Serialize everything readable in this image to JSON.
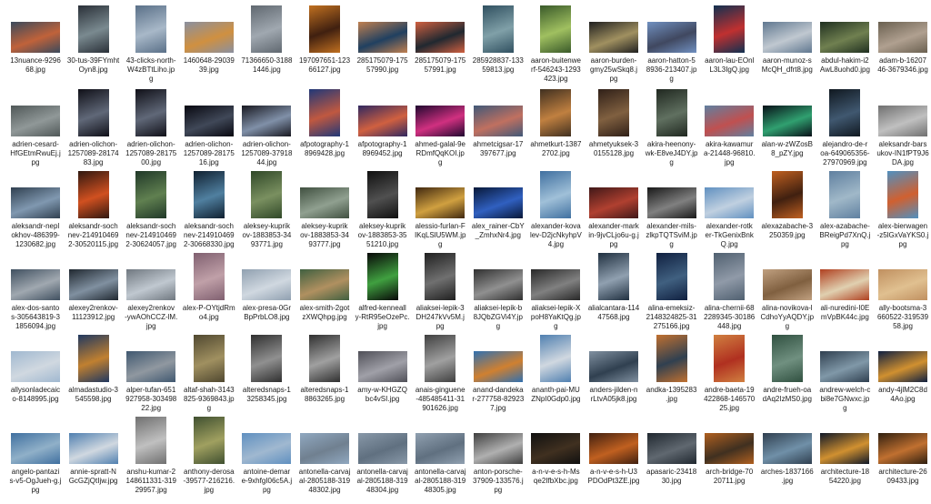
{
  "files": [
    [
      {
        "name": "13nuance-9296\n68.jpg",
        "c": "#3a4a5c",
        "c2": "#c0623a",
        "o": "l"
      },
      {
        "name": "30-tus-39FYmht\nOyn8.jpg",
        "c": "#2a3038",
        "c2": "#7a8a90",
        "o": "p"
      },
      {
        "name": "43-clicks-north-\nW4zBTtLiho.jp\ng",
        "c": "#5a7088",
        "c2": "#a8b8c8",
        "o": "p"
      },
      {
        "name": "1460648-29039\n39.jpg",
        "c": "#8a90a0",
        "c2": "#d09040",
        "o": "l"
      },
      {
        "name": "71366650-3188\n1446.jpg",
        "c": "#606870",
        "c2": "#a0a8b0",
        "o": "p"
      },
      {
        "name": "197097651-123\n66127.jpg",
        "c": "#c07020",
        "c2": "#402010",
        "o": "p"
      },
      {
        "name": "285175079-175\n57990.jpg",
        "c": "#c08050",
        "c2": "#204060",
        "o": "l"
      },
      {
        "name": "285175079-175\n57991.jpg",
        "c": "#d06040",
        "c2": "#202830",
        "o": "l"
      },
      {
        "name": "285928837-133\n59813.jpg",
        "c": "#305060",
        "c2": "#80a0a8",
        "o": "p"
      },
      {
        "name": "aaron-buitenwe\nrf-546243-1293\n423.jpg",
        "c": "#3a5a2a",
        "c2": "#a0c060",
        "o": "p"
      },
      {
        "name": "aaron-burden-\ngmy25wSkq8.j\npg",
        "c": "#202020",
        "c2": "#a09060",
        "o": "l"
      },
      {
        "name": "aaron-hatton-5\n8936-213407.jp\ng",
        "c": "#7090c0",
        "c2": "#404860",
        "o": "l"
      },
      {
        "name": "aaron-lau-EOnl\nL3L3IgQ.jpg",
        "c": "#103050",
        "c2": "#c03030",
        "o": "p"
      },
      {
        "name": "aaron-munoz-s\nMcQH_dfrt8.jpg",
        "c": "#607890",
        "c2": "#c0c8d0",
        "o": "l"
      },
      {
        "name": "abdul-hakim-i2\nAwL8uohd0.jpg",
        "c": "#203020",
        "c2": "#708050",
        "o": "l"
      },
      {
        "name": "adam-b-16207\n46-3679346.jpg",
        "c": "#6a6050",
        "c2": "#b0a090",
        "o": "l"
      }
    ],
    [
      {
        "name": "adrien-cesard-\nHfGEtmRwuEj.j\npg",
        "c": "#505858",
        "c2": "#909898",
        "o": "l"
      },
      {
        "name": "adrien-olichon-\n1257089-28174\n83.jpg",
        "c": "#101018",
        "c2": "#606878",
        "o": "p"
      },
      {
        "name": "adrien-olichon-\n1257089-28175\n00.jpg",
        "c": "#101018",
        "c2": "#606878",
        "o": "p"
      },
      {
        "name": "adrien-olichon-\n1257089-28175\n16.jpg",
        "c": "#080810",
        "c2": "#404858",
        "o": "l"
      },
      {
        "name": "adrien-olichon-\n1257089-37918\n44.jpg",
        "c": "#181820",
        "c2": "#8090a8",
        "o": "l"
      },
      {
        "name": "afpotography-1\n8969428.jpg",
        "c": "#203878",
        "c2": "#c05840",
        "o": "p"
      },
      {
        "name": "afpotography-1\n8969452.jpg",
        "c": "#302860",
        "c2": "#d06040",
        "o": "l"
      },
      {
        "name": "ahmed-galal-9e\nRDmfQqKOI.jp\ng",
        "c": "#200830",
        "c2": "#d03080",
        "o": "l"
      },
      {
        "name": "ahmetcigsar-17\n397677.jpg",
        "c": "#405878",
        "c2": "#c07060",
        "o": "l"
      },
      {
        "name": "ahmetkurt-1387\n2702.jpg",
        "c": "#403020",
        "c2": "#c08040",
        "o": "p"
      },
      {
        "name": "ahmetyuksek-3\n0155128.jpg",
        "c": "#302018",
        "c2": "#806040",
        "o": "p"
      },
      {
        "name": "akira-heenony-\nwk-E8veJ4DY.jp\ng",
        "c": "#202820",
        "c2": "#607060",
        "o": "p"
      },
      {
        "name": "akira-kawamur\na-21448-96810.\njpg",
        "c": "#6080a0",
        "c2": "#c05050",
        "o": "l"
      },
      {
        "name": "alan-w-zWZosB\n8_pZY.jpg",
        "c": "#081018",
        "c2": "#30a070",
        "o": "l"
      },
      {
        "name": "alejandro-de-r\noa-649065356-\n27970969.jpg",
        "c": "#101820",
        "c2": "#405870",
        "o": "p"
      },
      {
        "name": "aleksandr-bars\nukov-IN1fPT9J6\nDA.jpg",
        "c": "#707070",
        "c2": "#c0c0c0",
        "o": "l"
      }
    ],
    [
      {
        "name": "aleksandr-nepl\nokhov-486399-\n1230682.jpg",
        "c": "#304050",
        "c2": "#8098b0",
        "o": "l"
      },
      {
        "name": "aleksandr-soch\nnev-214910469\n2-30520115.jpg",
        "c": "#301810",
        "c2": "#d05020",
        "o": "p"
      },
      {
        "name": "aleksandr-soch\nnev-214910469\n2-30624057.jpg",
        "c": "#203828",
        "c2": "#608050",
        "o": "p"
      },
      {
        "name": "aleksandr-soch\nnev-214910469\n2-30668330.jpg",
        "c": "#102030",
        "c2": "#5080a0",
        "o": "p"
      },
      {
        "name": "aleksey-kuprik\nov-1883853-34\n93771.jpg",
        "c": "#304828",
        "c2": "#7a9060",
        "o": "p"
      },
      {
        "name": "aleksey-kuprik\nov-1883853-34\n93777.jpg",
        "c": "#405040",
        "c2": "#90a090",
        "o": "l"
      },
      {
        "name": "aleksey-kuprik\nov-1883853-35\n51210.jpg",
        "c": "#101010",
        "c2": "#505050",
        "o": "p"
      },
      {
        "name": "alessio-furlan-F\nIKqLSlU5WM.jp\ng",
        "c": "#402810",
        "c2": "#d0a040",
        "o": "l"
      },
      {
        "name": "alex_rainer-CbY\n_ZmhxNr4.jpg",
        "c": "#081838",
        "c2": "#3060c0",
        "o": "l"
      },
      {
        "name": "alexander-kova\nlev-D2jcNkyhpV\n4.jpg",
        "c": "#4070a0",
        "c2": "#a0c0d8",
        "o": "p"
      },
      {
        "name": "alexander-mark\nin-9jvCLjo6u-g.j\npg",
        "c": "#401818",
        "c2": "#b04030",
        "o": "l"
      },
      {
        "name": "alexander-mils-\nzlkpTQTSviM.jp\ng",
        "c": "#181818",
        "c2": "#808080",
        "o": "l"
      },
      {
        "name": "alexander-rotk\ner-TkGenixBnk\nQ.jpg",
        "c": "#6090c0",
        "c2": "#c0d0e0",
        "o": "l"
      },
      {
        "name": "alexazabache-3\n250359.jpg",
        "c": "#c06020",
        "c2": "#402010",
        "o": "p"
      },
      {
        "name": "alex-azabache-\nBReigPd7XnQ.j\npg",
        "c": "#6080a0",
        "c2": "#a0b8c8",
        "o": "p"
      },
      {
        "name": "alex-bierwagen\n-z5lGxVaYKS0.j\npg",
        "c": "#5090c0",
        "c2": "#d06030",
        "o": "p"
      }
    ],
    [
      {
        "name": "alex-dos-santo\ns-305643819-3\n1856094.jpg",
        "c": "#405060",
        "c2": "#a0a8b0",
        "o": "l"
      },
      {
        "name": "alexey2renkov-\n11123912.jpg",
        "c": "#202830",
        "c2": "#8090a0",
        "o": "l"
      },
      {
        "name": "alexey2renkov\n-ywAOhCCZ-lM.\njpg",
        "c": "#707880",
        "c2": "#c0c8d0",
        "o": "l"
      },
      {
        "name": "alex-P-OYtjdRm\no4.jpg",
        "c": "#806070",
        "c2": "#c0a0a8",
        "o": "p"
      },
      {
        "name": "alex-presa-0Gr\nBpPrbLO8.jpg",
        "c": "#90a0b0",
        "c2": "#d0d8e0",
        "o": "l"
      },
      {
        "name": "alex-smith-2got\nzXWQhpg.jpg",
        "c": "#406040",
        "c2": "#b09060",
        "o": "l"
      },
      {
        "name": "alfred-kenneall\ny-RtR95eOzePc.\njpg",
        "c": "#080808",
        "c2": "#40a040",
        "o": "p"
      },
      {
        "name": "aliaksei-lepik-3\nDH247kVv5M.j\npg",
        "c": "#202020",
        "c2": "#707070",
        "o": "p"
      },
      {
        "name": "aliaksei-lepik-b\n8JQbZGVi4Y.jp\ng",
        "c": "#303030",
        "c2": "#909090",
        "o": "l"
      },
      {
        "name": "aliaksei-lepik-X\npoH8YaKtQg.jp\ng",
        "c": "#282828",
        "c2": "#808080",
        "o": "l"
      },
      {
        "name": "alialcantara-114\n47568.jpg",
        "c": "#203040",
        "c2": "#90a0b0",
        "o": "p"
      },
      {
        "name": "alina-emeksiz-\n2148324825-31\n275166.jpg",
        "c": "#102040",
        "c2": "#406080",
        "o": "p"
      },
      {
        "name": "alina-chernii-68\n2289345-30186\n448.jpg",
        "c": "#506070",
        "c2": "#909aa8",
        "o": "p"
      },
      {
        "name": "alina-novikova-l\nCdhoYyAQDY.jp\ng",
        "c": "#c0a080",
        "c2": "#806040",
        "o": "l"
      },
      {
        "name": "ali-nuredini-I0E\nmVpBK44c.jpg",
        "c": "#b04020",
        "c2": "#e0d0b0",
        "o": "l"
      },
      {
        "name": "ally-bootsma-3\n660522-319539\n58.jpg",
        "c": "#c09060",
        "c2": "#e0c090",
        "o": "l"
      }
    ],
    [
      {
        "name": "allysonladecaic\no-8148995.jpg",
        "c": "#a0b8d0",
        "c2": "#d0d8e0",
        "o": "l"
      },
      {
        "name": "almadastudio-3\n545598.jpg",
        "c": "#203860",
        "c2": "#c08030",
        "o": "p"
      },
      {
        "name": "alper-tufan-651\n927958-303498\n22.jpg",
        "c": "#405870",
        "c2": "#9098a0",
        "o": "l"
      },
      {
        "name": "altaf-shah-3143\n825-9369843.jp\ng",
        "c": "#504830",
        "c2": "#a09060",
        "o": "p"
      },
      {
        "name": "alteredsnaps-1\n3258345.jpg",
        "c": "#303030",
        "c2": "#909090",
        "o": "p"
      },
      {
        "name": "alteredsnaps-1\n8863265.jpg",
        "c": "#303030",
        "c2": "#a0a0a0",
        "o": "p"
      },
      {
        "name": "amy-w-KHGZQ\nbc4vSI.jpg",
        "c": "#505058",
        "c2": "#a0a0a8",
        "o": "l"
      },
      {
        "name": "anais-ginguene\n-485485411-31\n901626.jpg",
        "c": "#404040",
        "c2": "#a0a0a0",
        "o": "p"
      },
      {
        "name": "anand-dandeka\nr-277758-82923\n7.jpg",
        "c": "#3070b0",
        "c2": "#d08030",
        "o": "l"
      },
      {
        "name": "ananth-pai-MU\nZNpI0Gdp0.jpg",
        "c": "#5080b0",
        "c2": "#d0d8e0",
        "o": "p"
      },
      {
        "name": "anders-jilden-n\nrLtvA05jk8.jpg",
        "c": "#8090a0",
        "c2": "#304050",
        "o": "l"
      },
      {
        "name": "andka-1395283\n.jpg",
        "c": "#c07030",
        "c2": "#304050",
        "o": "p"
      },
      {
        "name": "andre-baeta-19\n422868-146570\n25.jpg",
        "c": "#d08040",
        "c2": "#b03020",
        "o": "p"
      },
      {
        "name": "andre-frueh-oa\ndAq2IzMS0.jpg",
        "c": "#305040",
        "c2": "#709080",
        "o": "p"
      },
      {
        "name": "andrew-welch-c\nbi8e7GNwxc.jp\ng",
        "c": "#304050",
        "c2": "#8098a8",
        "o": "l"
      },
      {
        "name": "andy-4jlM2C8d\n4Ao.jpg",
        "c": "#102040",
        "c2": "#d09030",
        "o": "l"
      }
    ],
    [
      {
        "name": "angelo-pantazi\ns-v5-OgJueh-g.j\npg",
        "c": "#4070a0",
        "c2": "#90b0c8",
        "o": "l"
      },
      {
        "name": "annie-spratt-N\nGcGZjQtIjw.jpg",
        "c": "#5080b0",
        "c2": "#d0d8e0",
        "o": "l"
      },
      {
        "name": "anshu-kumar-2\n148611331-319\n29957.jpg",
        "c": "#707070",
        "c2": "#c0c0c0",
        "o": "p"
      },
      {
        "name": "anthony-derosa\n-39577-216216.\njpg",
        "c": "#405030",
        "c2": "#a0a060",
        "o": "p"
      },
      {
        "name": "antoine-demar\ne-9xhfgI06c5A.j\npg",
        "c": "#6090c0",
        "c2": "#a0b8d0",
        "o": "l"
      },
      {
        "name": "antonella-carvaj\nal-2805188-319\n48302.jpg",
        "c": "#90a8c0",
        "c2": "#708090",
        "o": "l"
      },
      {
        "name": "antonella-carvaj\nal-2805188-319\n48304.jpg",
        "c": "#8898a8",
        "c2": "#607080",
        "o": "l"
      },
      {
        "name": "antonella-carvaj\nal-2805188-319\n48305.jpg",
        "c": "#90a0b0",
        "c2": "#607080",
        "o": "l"
      },
      {
        "name": "anton-porsche-\n37909-133576.j\npg",
        "c": "#404040",
        "c2": "#b0b0b0",
        "o": "l"
      },
      {
        "name": "a-n-v-e-s-h-Ms\nqe2IfbXbc.jpg",
        "c": "#101010",
        "c2": "#403020",
        "o": "l"
      },
      {
        "name": "a-n-v-e-s-h-U3\nPDOdPt3ZE.jpg",
        "c": "#402010",
        "c2": "#c06020",
        "o": "l"
      },
      {
        "name": "apasaric-23418\n30.jpg",
        "c": "#202830",
        "c2": "#606870",
        "o": "l"
      },
      {
        "name": "arch-bridge-70\n20711.jpg",
        "c": "#b06020",
        "c2": "#403020",
        "o": "l"
      },
      {
        "name": "arches-1837166\n.jpg",
        "c": "#304050",
        "c2": "#7090a8",
        "o": "l"
      },
      {
        "name": "architecture-18\n54220.jpg",
        "c": "#101828",
        "c2": "#d09030",
        "o": "l"
      },
      {
        "name": "architecture-26\n09433.jpg",
        "c": "#302010",
        "c2": "#c07030",
        "o": "l"
      }
    ]
  ]
}
